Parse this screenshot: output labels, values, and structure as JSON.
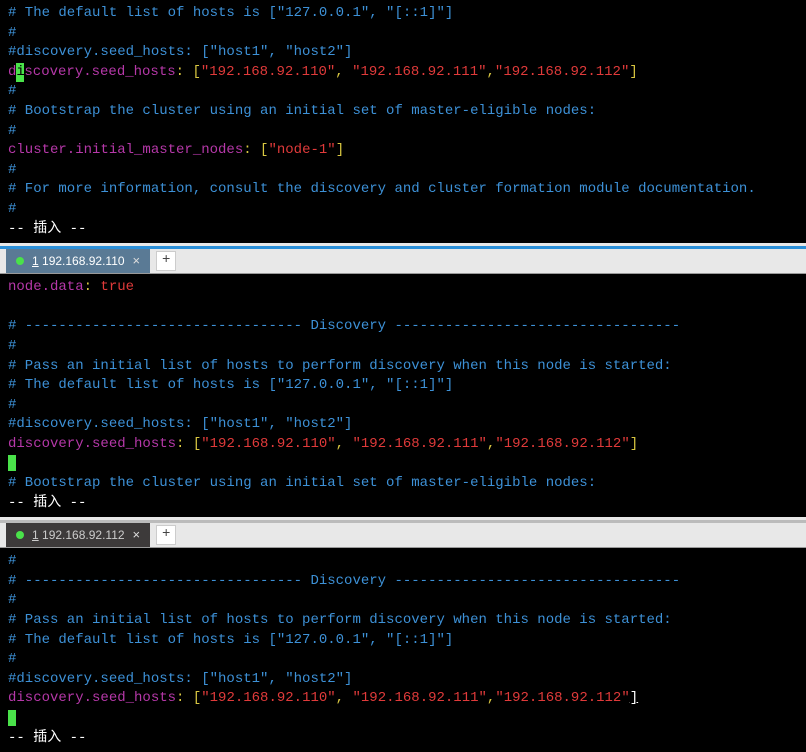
{
  "pane1": {
    "l1": "# The default list of hosts is [\"127.0.0.1\", \"[::1]\"]",
    "l2": "#",
    "l3": "#discovery.seed_hosts: [\"host1\", \"host2\"]",
    "l4_pre": "d",
    "l4_cursor": "i",
    "l4_post": "scovery.seed_hosts",
    "l4_colon": ":",
    "l4_bracket_open": " [",
    "l4_ip1": "\"192.168.92.110\"",
    "l4_c1": ", ",
    "l4_ip2": "\"192.168.92.111\"",
    "l4_c2": ",",
    "l4_ip3": "\"192.168.92.112\"",
    "l4_bracket_close": "]",
    "l5": "#",
    "l6": "# Bootstrap the cluster using an initial set of master-eligible nodes:",
    "l7": "#",
    "l8_key": "cluster.initial_master_nodes",
    "l8_colon": ":",
    "l8_bracket_open": " [",
    "l8_val": "\"node-1\"",
    "l8_bracket_close": "]",
    "l9": "#",
    "l10": "# For more information, consult the discovery and cluster formation module documentation.",
    "l11": "#",
    "status": "-- 插入 --"
  },
  "tab2": {
    "num": "1",
    "label": " 192.168.92.110"
  },
  "pane2": {
    "l1_key": "node.data",
    "l1_colon": ":",
    "l1_val": " true",
    "l2_blank": " ",
    "l3": "# --------------------------------- Discovery ----------------------------------",
    "l4": "#",
    "l5": "# Pass an initial list of hosts to perform discovery when this node is started:",
    "l6": "# The default list of hosts is [\"127.0.0.1\", \"[::1]\"]",
    "l7": "#",
    "l8": "#discovery.seed_hosts: [\"host1\", \"host2\"]",
    "l9_key": "discovery.seed_hosts",
    "l9_colon": ":",
    "l9_bracket_open": " [",
    "l9_ip1": "\"192.168.92.110\"",
    "l9_c1": ", ",
    "l9_ip2": "\"192.168.92.111\"",
    "l9_c2": ",",
    "l9_ip3": "\"192.168.92.112\"",
    "l9_bracket_close": "]",
    "l11": "# Bootstrap the cluster using an initial set of master-eligible nodes:",
    "status": "-- 插入 --"
  },
  "tab3": {
    "num": "1",
    "label": " 192.168.92.112"
  },
  "pane3": {
    "l1": "#",
    "l2": "# --------------------------------- Discovery ----------------------------------",
    "l3": "#",
    "l4": "# Pass an initial list of hosts to perform discovery when this node is started:",
    "l5": "# The default list of hosts is [\"127.0.0.1\", \"[::1]\"]",
    "l6": "#",
    "l7": "#discovery.seed_hosts: [\"host1\", \"host2\"]",
    "l8_key": "discovery.seed_hosts",
    "l8_colon": ":",
    "l8_bracket_open": " [",
    "l8_ip1": "\"192.168.92.110\"",
    "l8_c1": ", ",
    "l8_ip2": "\"192.168.92.111\"",
    "l8_c2": ",",
    "l8_ip3": "\"192.168.92.112\"",
    "l8_bracket_close": "]",
    "status": "-- 插入 --"
  }
}
